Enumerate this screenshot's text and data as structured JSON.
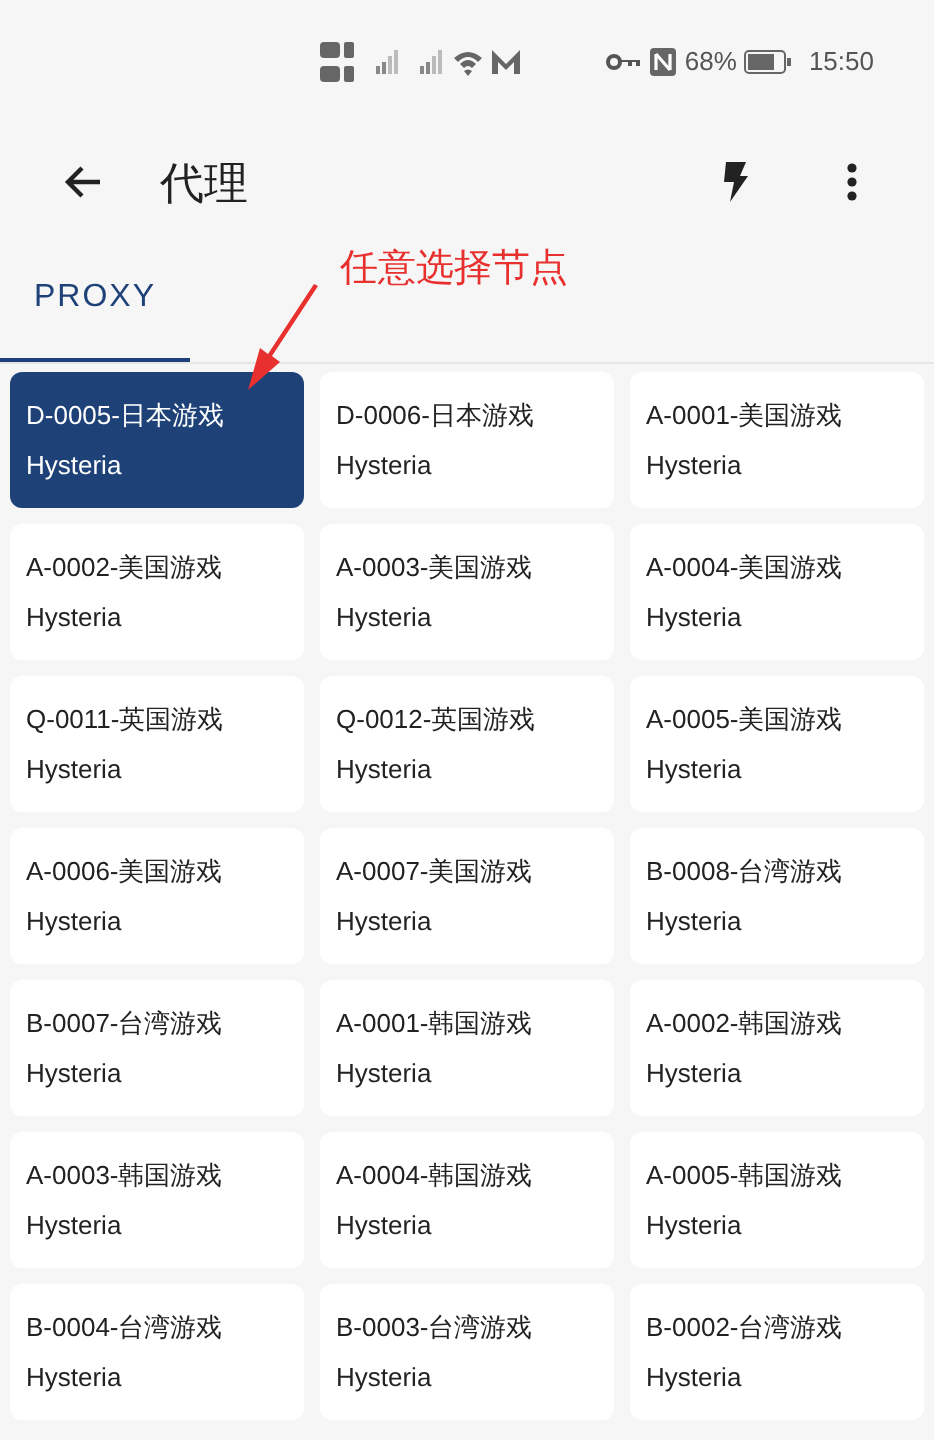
{
  "status_bar": {
    "battery": "68%",
    "time": "15:50"
  },
  "app_bar": {
    "title": "代理"
  },
  "tabs": [
    {
      "label": "PROXY",
      "selected": true
    }
  ],
  "annotation": {
    "text": "任意选择节点"
  },
  "proxies": [
    {
      "name": "D-0005-日本游戏",
      "type": "Hysteria",
      "selected": true
    },
    {
      "name": "D-0006-日本游戏",
      "type": "Hysteria",
      "selected": false
    },
    {
      "name": "A-0001-美国游戏",
      "type": "Hysteria",
      "selected": false
    },
    {
      "name": "A-0002-美国游戏",
      "type": "Hysteria",
      "selected": false
    },
    {
      "name": "A-0003-美国游戏",
      "type": "Hysteria",
      "selected": false
    },
    {
      "name": "A-0004-美国游戏",
      "type": "Hysteria",
      "selected": false
    },
    {
      "name": "Q-0011-英国游戏",
      "type": "Hysteria",
      "selected": false
    },
    {
      "name": "Q-0012-英国游戏",
      "type": "Hysteria",
      "selected": false
    },
    {
      "name": "A-0005-美国游戏",
      "type": "Hysteria",
      "selected": false
    },
    {
      "name": "A-0006-美国游戏",
      "type": "Hysteria",
      "selected": false
    },
    {
      "name": "A-0007-美国游戏",
      "type": "Hysteria",
      "selected": false
    },
    {
      "name": "B-0008-台湾游戏",
      "type": "Hysteria",
      "selected": false
    },
    {
      "name": "B-0007-台湾游戏",
      "type": "Hysteria",
      "selected": false
    },
    {
      "name": "A-0001-韩国游戏",
      "type": "Hysteria",
      "selected": false
    },
    {
      "name": "A-0002-韩国游戏",
      "type": "Hysteria",
      "selected": false
    },
    {
      "name": "A-0003-韩国游戏",
      "type": "Hysteria",
      "selected": false
    },
    {
      "name": "A-0004-韩国游戏",
      "type": "Hysteria",
      "selected": false
    },
    {
      "name": "A-0005-韩国游戏",
      "type": "Hysteria",
      "selected": false
    },
    {
      "name": "B-0004-台湾游戏",
      "type": "Hysteria",
      "selected": false
    },
    {
      "name": "B-0003-台湾游戏",
      "type": "Hysteria",
      "selected": false
    },
    {
      "name": "B-0002-台湾游戏",
      "type": "Hysteria",
      "selected": false
    }
  ]
}
